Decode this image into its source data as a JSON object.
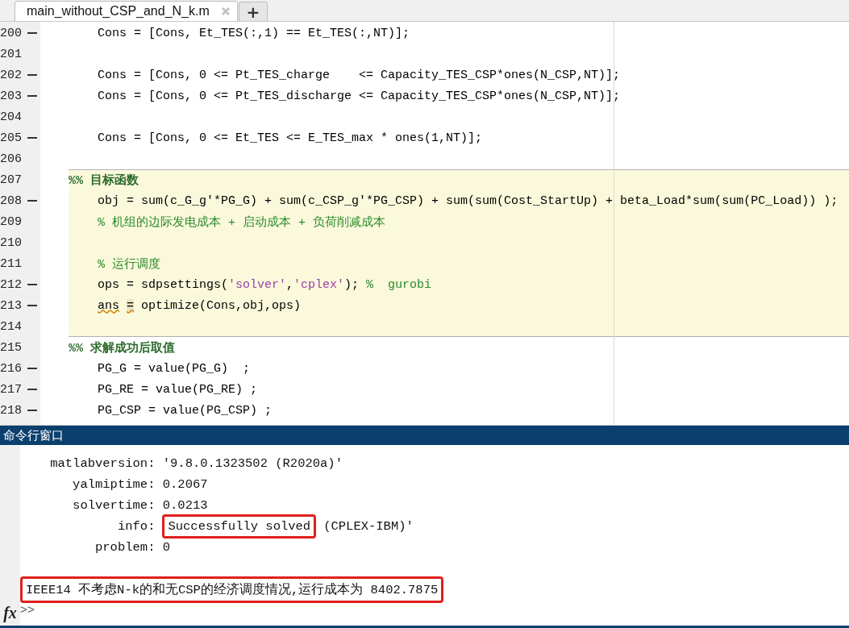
{
  "tabs": [
    {
      "label": "main_without_CSP_and_N_k.m",
      "selected": true
    },
    {
      "label": "+",
      "kind": "add"
    }
  ],
  "editor": {
    "lines": [
      {
        "number": "200",
        "kind": "code",
        "executable": true,
        "segments": [
          {
            "kind": "code",
            "text": "Cons = [Cons, Et_TES(:,1) == Et_TES(:,NT)];"
          }
        ]
      },
      {
        "number": "201",
        "kind": "blank",
        "executable": false
      },
      {
        "number": "202",
        "kind": "code",
        "executable": true,
        "segments": [
          {
            "kind": "code",
            "text": "Cons = [Cons, 0 <= Pt_TES_charge    <= Capacity_TES_CSP*ones(N_CSP,NT)];"
          }
        ]
      },
      {
        "number": "203",
        "kind": "code",
        "executable": true,
        "segments": [
          {
            "kind": "code",
            "text": "Cons = [Cons, 0 <= Pt_TES_discharge <= Capacity_TES_CSP*ones(N_CSP,NT)];"
          }
        ]
      },
      {
        "number": "204",
        "kind": "blank",
        "executable": false
      },
      {
        "number": "205",
        "kind": "code",
        "executable": true,
        "segments": [
          {
            "kind": "code",
            "text": "Cons = [Cons, 0 <= Et_TES <= E_TES_max * ones(1,NT)];"
          }
        ]
      },
      {
        "number": "206",
        "kind": "blank",
        "executable": false
      },
      {
        "number": "207",
        "kind": "section",
        "executable": false,
        "cell": true,
        "segments": [
          {
            "kind": "section",
            "text": "%% 目标函数"
          }
        ]
      },
      {
        "number": "208",
        "kind": "code",
        "executable": true,
        "cell": true,
        "segments": [
          {
            "kind": "code",
            "text": "obj = sum(c_G_g'*PG_G) + sum(c_CSP_g'*PG_CSP) + sum(sum(Cost_StartUp) + beta_Load*sum(sum(PC_Load)) );"
          }
        ]
      },
      {
        "number": "209",
        "kind": "code",
        "executable": false,
        "cell": true,
        "segments": [
          {
            "kind": "comment",
            "text": "% 机组的边际发电成本 + 启动成本 + 负荷削减成本"
          }
        ]
      },
      {
        "number": "210",
        "kind": "blank",
        "executable": false,
        "cell": true
      },
      {
        "number": "211",
        "kind": "code",
        "executable": false,
        "cell": true,
        "segments": [
          {
            "kind": "comment",
            "text": "% 运行调度"
          }
        ]
      },
      {
        "number": "212",
        "kind": "code",
        "executable": true,
        "cell": true,
        "segments": [
          {
            "kind": "code",
            "text": "ops = sdpsettings("
          },
          {
            "kind": "string",
            "text": "'solver'"
          },
          {
            "kind": "code",
            "text": ","
          },
          {
            "kind": "string",
            "text": "'cplex'"
          },
          {
            "kind": "code",
            "text": "); "
          },
          {
            "kind": "comment",
            "text": "%  gurobi"
          }
        ]
      },
      {
        "number": "213",
        "kind": "code",
        "executable": true,
        "cell": true,
        "segments": [
          {
            "kind": "warning",
            "text": "ans"
          },
          {
            "kind": "warnmark",
            "text": "="
          },
          {
            "kind": "code",
            "text": " optimize(Cons,obj,ops)"
          }
        ]
      },
      {
        "number": "214",
        "kind": "blank",
        "executable": false,
        "cell": true
      },
      {
        "number": "215",
        "kind": "section",
        "executable": false,
        "segments": [
          {
            "kind": "section",
            "text": "%% 求解成功后取值"
          }
        ]
      },
      {
        "number": "216",
        "kind": "code",
        "executable": true,
        "segments": [
          {
            "kind": "code",
            "text": "PG_G = value(PG_G)  ;"
          }
        ]
      },
      {
        "number": "217",
        "kind": "code",
        "executable": true,
        "segments": [
          {
            "kind": "code",
            "text": "PG_RE = value(PG_RE) ;"
          }
        ]
      },
      {
        "number": "218",
        "kind": "code",
        "executable": true,
        "segments": [
          {
            "kind": "code",
            "text": "PG_CSP = value(PG_CSP) ;"
          }
        ]
      }
    ]
  },
  "command_window": {
    "title": "命令行窗口",
    "lines": [
      {
        "kind": "text",
        "segments": [
          {
            "text": "    matlabversion: '9.8.0.1323502 (R2020a)'",
            "boxed": false
          }
        ]
      },
      {
        "kind": "text",
        "segments": [
          {
            "text": "       yalmiptime: 0.2067",
            "boxed": false
          }
        ]
      },
      {
        "kind": "text",
        "segments": [
          {
            "text": "       solvertime: 0.0213",
            "boxed": false
          }
        ]
      },
      {
        "kind": "text",
        "segments": [
          {
            "text": "             info:",
            "boxed": false
          },
          {
            "text": "Successfully solved",
            "boxed": true
          },
          {
            "text": "(CPLEX-IBM)'",
            "boxed": false
          }
        ]
      },
      {
        "kind": "text",
        "segments": [
          {
            "text": "          problem: 0",
            "boxed": false
          }
        ]
      },
      {
        "kind": "blank"
      },
      {
        "kind": "text",
        "segments": [
          {
            "text": "IEEE14 不考虑N-k的和无CSP的经济调度情况,运行成本为 8402.7875",
            "boxed": true
          }
        ]
      }
    ],
    "fx_label": "fx",
    "prompt": ">>"
  }
}
